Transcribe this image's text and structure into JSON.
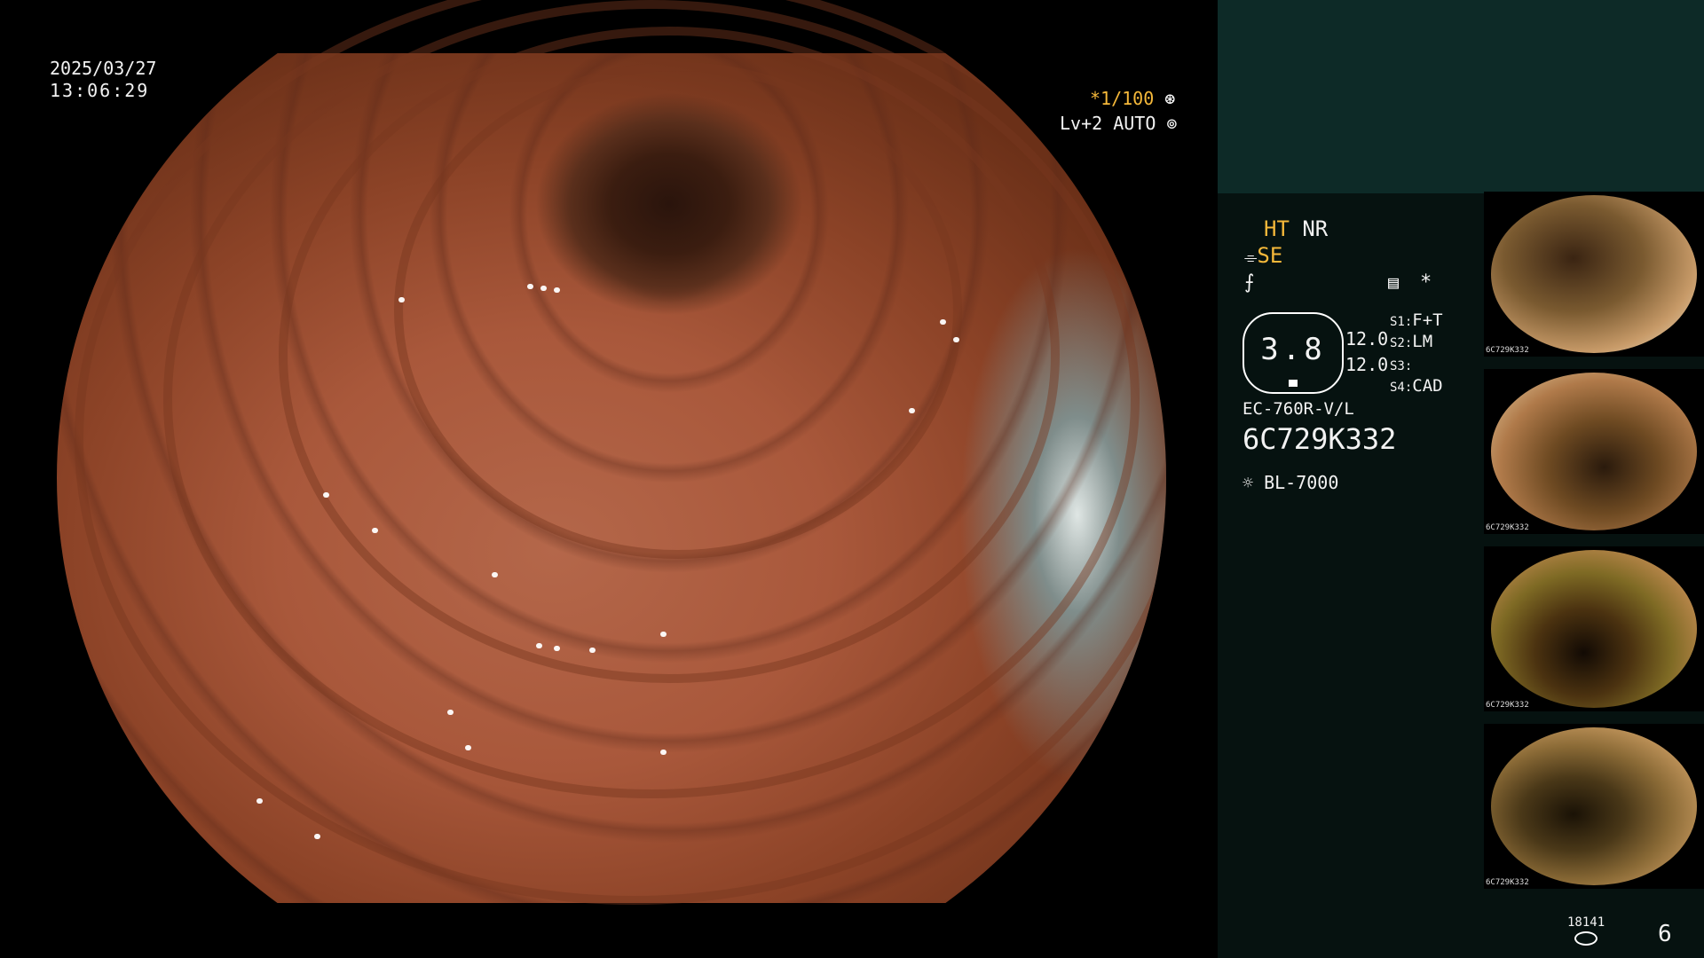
{
  "overlay": {
    "date": "2025/03/27",
    "time": "13:06:29",
    "shutter": "*1/100",
    "level": "Lv+2 AUTO"
  },
  "panel": {
    "ht": "HT",
    "nr": "NR",
    "se": "SE",
    "star": "*",
    "value_center": "3.8",
    "value_a": "12.0",
    "value_b": "12.0",
    "s1_label": "S1:",
    "s1_value": "F+T",
    "s2_label": "S2:",
    "s2_value": "LM",
    "s3_label": "S3:",
    "s3_value": "",
    "s4_label": "S4:",
    "s4_value": "CAD",
    "model": "EC-760R-V/L",
    "serial": "6C729K332",
    "light_source": "BL-7000",
    "storage_count": "18141",
    "image_count": "6"
  },
  "thumbnails": [
    {
      "caption": "6C729K332"
    },
    {
      "caption": "6C729K332"
    },
    {
      "caption": "6C729K332"
    },
    {
      "caption": "6C729K332"
    }
  ],
  "colors": {
    "accent": "#f5b83a",
    "panel_bg": "#061210",
    "panel_top": "#0d2a27",
    "tissue": "#b4674a"
  },
  "icons": [
    "shutter-icon",
    "auto-iris-icon",
    "scope-icon",
    "settings-icon",
    "light-icon",
    "disk-icon"
  ]
}
